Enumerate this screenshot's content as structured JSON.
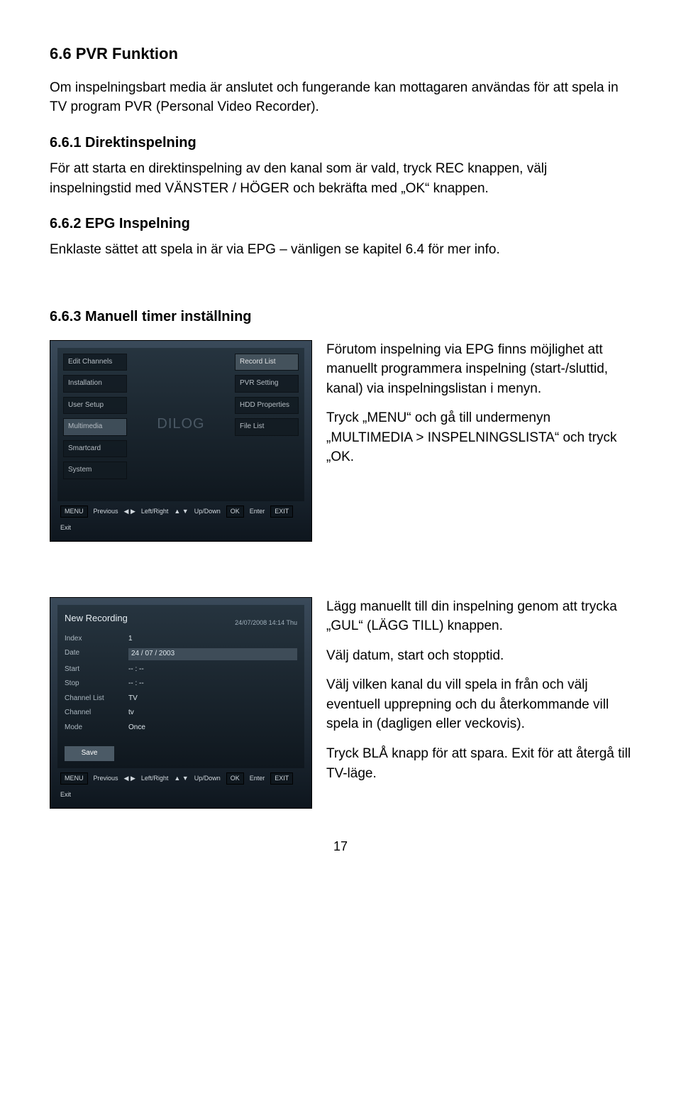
{
  "sec66": {
    "title": "6.6  PVR Funktion"
  },
  "p_intro": "Om inspelningsbart media är anslutet och fungerande kan mottagaren användas för att spela in TV program PVR (Personal Video Recorder).",
  "sec661": {
    "title": "6.6.1  Direktinspelning"
  },
  "p_661": "För att starta en direktinspelning av den kanal som är vald, tryck REC knappen, välj inspelningstid med VÄNSTER / HÖGER och bekräfta med „OK“ knappen.",
  "sec662": {
    "title": "6.6.2  EPG Inspelning"
  },
  "p_662": "Enklaste sättet att spela in är via EPG – vänligen se kapitel 6.4 för mer info.",
  "sec663": {
    "title": "6.6.3  Manuell timer inställning"
  },
  "p_663a": "Förutom inspelning via EPG finns möjlighet att manuellt programmera inspelning (start-/sluttid, kanal) via inspelningslistan i menyn.",
  "p_663b": "Tryck „MENU“ och gå till undermenyn „MULTIMEDIA > INSPELNINGSLISTA“ och tryck „OK.",
  "p_664a": "Lägg manuellt till din inspelning genom att trycka „GUL“ (LÄGG TILL) knappen.",
  "p_664b": "Välj datum, start och stopptid.",
  "p_664c": "Välj vilken kanal du vill spela in från och välj eventuell upprepning och du återkommande vill spela in (dagligen eller veckovis).",
  "p_664d": "Tryck BLÅ knapp för att spara. Exit för att återgå till TV-läge.",
  "pagenum": "17",
  "tv1": {
    "left": [
      "Edit Channels",
      "Installation",
      "User Setup",
      "Multimedia",
      "Smartcard",
      "System"
    ],
    "right": [
      "Record List",
      "PVR Setting",
      "HDD Properties",
      "File List"
    ],
    "mid": "DILOG",
    "footer": {
      "menu": "MENU",
      "prev": "Previous",
      "lr": "Left/Right",
      "ud": "Up/Down",
      "ok": "OK",
      "enter": "Enter",
      "exit": "EXIT",
      "exitlbl": "Exit"
    }
  },
  "tv2": {
    "title": "New Recording",
    "ts": "24/07/2008 14:14 Thu",
    "rows": [
      {
        "lbl": "Index",
        "val": "1"
      },
      {
        "lbl": "Date",
        "val": "24 / 07 / 2003",
        "sel": true
      },
      {
        "lbl": "Start",
        "val": "-- : --"
      },
      {
        "lbl": "Stop",
        "val": "-- : --"
      },
      {
        "lbl": "Channel List",
        "val": "TV"
      },
      {
        "lbl": "Channel",
        "val": "tv"
      },
      {
        "lbl": "Mode",
        "val": "Once"
      }
    ],
    "save": "Save",
    "footer": {
      "menu": "MENU",
      "prev": "Previous",
      "lr": "Left/Right",
      "ud": "Up/Down",
      "ok": "OK",
      "enter": "Enter",
      "exit": "EXIT",
      "exitlbl": "Exit"
    }
  }
}
